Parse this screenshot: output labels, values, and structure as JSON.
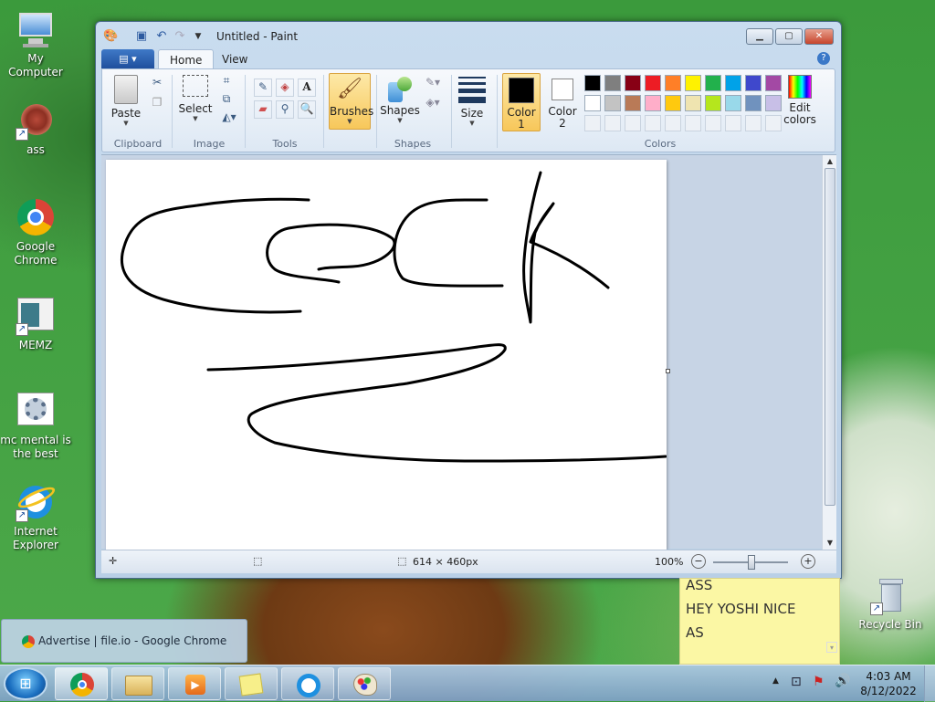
{
  "desktop": {
    "icons": [
      {
        "label_lines": [
          "My Computer"
        ],
        "icon": "computer-icon"
      },
      {
        "label_lines": [
          "ass"
        ],
        "icon": "red-pattern-shortcut-icon"
      },
      {
        "label_lines": [
          "Google",
          "Chrome"
        ],
        "icon": "chrome-icon"
      },
      {
        "label_lines": [
          "MEMZ"
        ],
        "icon": "memz-shortcut-icon"
      },
      {
        "label_lines": [
          "mc mental is",
          "the best"
        ],
        "icon": "gear-shortcut-icon"
      },
      {
        "label_lines": [
          "Internet",
          "Explorer"
        ],
        "icon": "internet-explorer-icon"
      },
      {
        "label_lines": [
          "Recycle Bin"
        ],
        "icon": "recycle-bin-icon"
      }
    ]
  },
  "paint": {
    "title": "Untitled - Paint",
    "tabs": [
      "Home",
      "View"
    ],
    "ribbon": {
      "clipboard": {
        "paste": "Paste",
        "label": "Clipboard"
      },
      "image": {
        "select": "Select",
        "label": "Image"
      },
      "tools": {
        "label": "Tools",
        "text_tool": "A"
      },
      "brushes": {
        "label": "Brushes"
      },
      "shapes": {
        "shapes_button": "Shapes",
        "label": "Shapes"
      },
      "size": {
        "label": "Size"
      },
      "colors": {
        "color1": "Color",
        "color1_num": "1",
        "color2": "Color",
        "color2_num": "2",
        "edit1": "Edit",
        "edit2": "colors",
        "label": "Colors",
        "palette_row1": [
          "#000000",
          "#7f7f7f",
          "#880015",
          "#ed1c24",
          "#ff7f27",
          "#fff200",
          "#22b14c",
          "#00a2e8",
          "#3f48cc",
          "#a349a4"
        ],
        "palette_row2": [
          "#ffffff",
          "#c3c3c3",
          "#b97a57",
          "#ffaec9",
          "#ffc90e",
          "#efe4b0",
          "#b5e61d",
          "#99d9ea",
          "#7092be",
          "#c8bfe7"
        ]
      }
    },
    "status": {
      "dimensions": "614 × 460px",
      "zoom": "100%"
    }
  },
  "sticky_note": {
    "lines": [
      "ASS",
      "HEY YOSHI NICE",
      "AS"
    ]
  },
  "taskbar": {
    "thumbnail_title": "Advertise | file.io - Google Chrome",
    "buttons": [
      "chrome-button",
      "explorer-button",
      "media-player-button",
      "sticky-notes-button",
      "internet-explorer-button",
      "paint-button"
    ],
    "clock": {
      "time": "4:03 AM",
      "date": "8/12/2022"
    }
  }
}
